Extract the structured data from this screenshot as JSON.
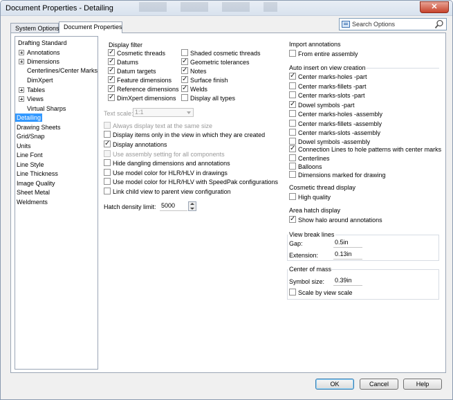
{
  "window": {
    "title": "Document Properties - Detailing",
    "close_glyph": "✕"
  },
  "tabs": [
    {
      "label": "System Options",
      "active": false
    },
    {
      "label": "Document Properties",
      "active": true
    }
  ],
  "search": {
    "placeholder": "Search Options",
    "icon": "search-icon"
  },
  "tree": [
    {
      "label": "Drafting Standard",
      "expandable": false,
      "selected": false
    },
    {
      "label": "Annotations",
      "expandable": true,
      "selected": false
    },
    {
      "label": "Dimensions",
      "expandable": true,
      "selected": false
    },
    {
      "label": "Centerlines/Center Marks",
      "expandable": false,
      "selected": false
    },
    {
      "label": "DimXpert",
      "expandable": false,
      "selected": false
    },
    {
      "label": "Tables",
      "expandable": true,
      "selected": false
    },
    {
      "label": "Views",
      "expandable": true,
      "selected": false
    },
    {
      "label": "Virtual Sharps",
      "expandable": false,
      "selected": false
    },
    {
      "label": "Detailing",
      "expandable": false,
      "selected": true
    },
    {
      "label": "Drawing Sheets",
      "expandable": false,
      "selected": false
    },
    {
      "label": "Grid/Snap",
      "expandable": false,
      "selected": false
    },
    {
      "label": "Units",
      "expandable": false,
      "selected": false
    },
    {
      "label": "Line Font",
      "expandable": false,
      "selected": false
    },
    {
      "label": "Line Style",
      "expandable": false,
      "selected": false
    },
    {
      "label": "Line Thickness",
      "expandable": false,
      "selected": false
    },
    {
      "label": "Image Quality",
      "expandable": false,
      "selected": false
    },
    {
      "label": "Sheet Metal",
      "expandable": false,
      "selected": false
    },
    {
      "label": "Weldments",
      "expandable": false,
      "selected": false
    }
  ],
  "display_filter": {
    "title": "Display filter",
    "col1": [
      {
        "label": "Cosmetic threads",
        "checked": true
      },
      {
        "label": "Datums",
        "checked": true
      },
      {
        "label": "Datum targets",
        "checked": true
      },
      {
        "label": "Feature dimensions",
        "checked": true
      },
      {
        "label": "Reference dimensions",
        "checked": true
      },
      {
        "label": "DimXpert dimensions",
        "checked": true
      }
    ],
    "col2": [
      {
        "label": "Shaded cosmetic threads",
        "checked": false
      },
      {
        "label": "Geometric tolerances",
        "checked": true
      },
      {
        "label": "Notes",
        "checked": true
      },
      {
        "label": "Surface finish",
        "checked": true
      },
      {
        "label": "Welds",
        "checked": true
      },
      {
        "label": "Display all types",
        "checked": false
      }
    ]
  },
  "text_scale": {
    "label": "Text scale:",
    "value": "1:1"
  },
  "options": [
    {
      "label": "Always display text at the same size",
      "checked": false,
      "disabled": true
    },
    {
      "label": "Display items only in the view in which they are created",
      "checked": false,
      "disabled": false
    },
    {
      "label": "Display annotations",
      "checked": true,
      "disabled": false
    },
    {
      "label": "Use assembly setting for all components",
      "checked": false,
      "disabled": true
    },
    {
      "label": "Hide dangling dimensions and annotations",
      "checked": false,
      "disabled": false
    },
    {
      "label": "Use model color for HLR/HLV in drawings",
      "checked": false,
      "disabled": false
    },
    {
      "label": "Use model color for HLR/HLV with SpeedPak configurations",
      "checked": false,
      "disabled": false
    },
    {
      "label": "Link child view to parent view configuration",
      "checked": false,
      "disabled": false
    }
  ],
  "hatch": {
    "label": "Hatch density limit:",
    "value": "5000"
  },
  "import_annotations": {
    "title": "Import annotations",
    "items": [
      {
        "label": "From entire assembly",
        "checked": false
      }
    ]
  },
  "auto_insert": {
    "title": "Auto insert on view creation",
    "items": [
      {
        "label": "Center marks-holes -part",
        "checked": true
      },
      {
        "label": "Center marks-fillets -part",
        "checked": false
      },
      {
        "label": "Center marks-slots -part",
        "checked": false
      },
      {
        "label": "Dowel symbols -part",
        "checked": true
      },
      {
        "label": "Center marks-holes -assembly",
        "checked": false
      },
      {
        "label": "Center marks-fillets -assembly",
        "checked": false
      },
      {
        "label": "Center marks-slots -assembly",
        "checked": false
      },
      {
        "label": "Dowel symbols -assembly",
        "checked": false
      },
      {
        "label": "Connection Lines to hole patterns with center marks",
        "checked": true
      },
      {
        "label": "Centerlines",
        "checked": false
      },
      {
        "label": "Balloons",
        "checked": false
      },
      {
        "label": "Dimensions marked for drawing",
        "checked": false
      }
    ]
  },
  "cosmetic_thread": {
    "title": "Cosmetic thread display",
    "items": [
      {
        "label": "High quality",
        "checked": false
      }
    ]
  },
  "area_hatch": {
    "title": "Area hatch display",
    "items": [
      {
        "label": "Show halo around annotations",
        "checked": true
      }
    ]
  },
  "view_break": {
    "title": "View break lines",
    "gap_label": "Gap:",
    "gap_value": "0.5in",
    "ext_label": "Extension:",
    "ext_value": "0.13in"
  },
  "center_of_mass": {
    "title": "Center of mass",
    "size_label": "Symbol size:",
    "size_value": "0.39in",
    "scale_label": "Scale by view scale",
    "scale_checked": false
  },
  "buttons": {
    "ok": "OK",
    "cancel": "Cancel",
    "help": "Help"
  }
}
